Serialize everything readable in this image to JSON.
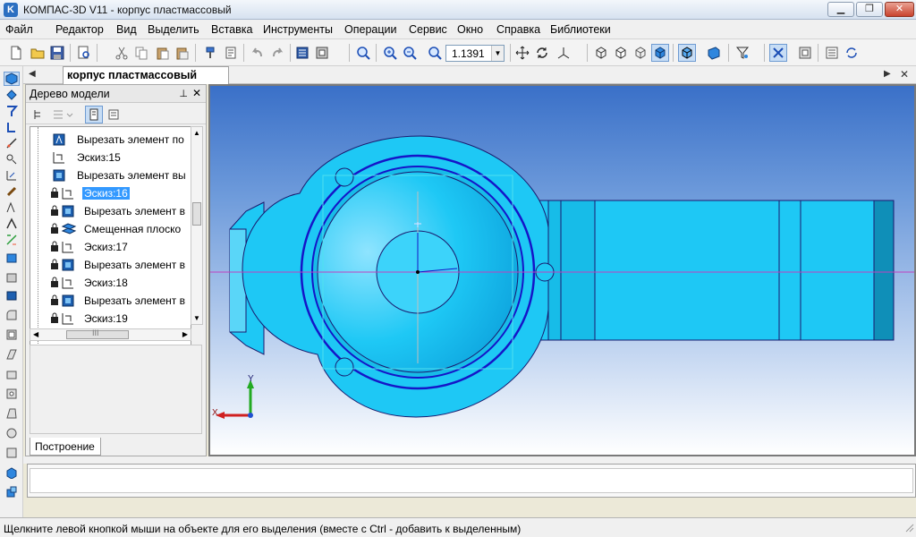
{
  "window": {
    "title": "КОМПАС-3D V11 - корпус пластмассовый",
    "app_icon_letter": "K",
    "minimize_glyph": "▁",
    "restore_glyph": "❐",
    "close_glyph": "✕"
  },
  "menu": [
    {
      "label": "Файл"
    },
    {
      "label": "Редактор"
    },
    {
      "label": "Вид"
    },
    {
      "label": "Выделить"
    },
    {
      "label": "Вставка"
    },
    {
      "label": "Инструменты"
    },
    {
      "label": "Операции"
    },
    {
      "label": "Сервис"
    },
    {
      "label": "Окно"
    },
    {
      "label": "Справка"
    },
    {
      "label": "Библиотеки"
    }
  ],
  "toolbar": {
    "zoom_value": "1.1391",
    "icons": [
      "new-document-icon",
      "open-folder-icon",
      "save-icon",
      "print-preview-icon",
      "cut-icon",
      "copy-icon",
      "paste-icon",
      "format-painter-icon",
      "undo-icon",
      "redo-icon",
      "manager-icon",
      "view-manager-icon",
      "zoom-window-icon",
      "zoom-in-icon",
      "zoom-out-icon",
      "zoom-scale-icon",
      "pan-icon",
      "rotate-icon",
      "orientation-icon",
      "wireframe-icon",
      "hidden-lines-icon",
      "hidden-thin-icon",
      "halftone-icon",
      "halftone-edges-icon",
      "perspective-icon",
      "filter-icon",
      "snap-icon",
      "library-icon",
      "variables-icon",
      "refresh-icon"
    ]
  },
  "document_tab": {
    "label": "корпус пластмассовый"
  },
  "tree": {
    "header": "Дерево модели",
    "pin_glyph": "⊥",
    "close_glyph": "✕",
    "items": [
      {
        "label": "Вырезать элемент по",
        "icon": "cut-extrude-path-icon",
        "locked": false,
        "selected": false
      },
      {
        "label": "Эскиз:15",
        "icon": "sketch-icon",
        "locked": false,
        "selected": false
      },
      {
        "label": "Вырезать элемент вы",
        "icon": "cut-extrude-icon",
        "locked": false,
        "selected": false
      },
      {
        "label": "Эскиз:16",
        "icon": "sketch-icon",
        "locked": true,
        "selected": true
      },
      {
        "label": "Вырезать элемент в",
        "icon": "cut-extrude-icon",
        "locked": true,
        "selected": false
      },
      {
        "label": "Смещенная плоско",
        "icon": "offset-plane-icon",
        "locked": true,
        "selected": false
      },
      {
        "label": "Эскиз:17",
        "icon": "sketch-icon",
        "locked": true,
        "selected": false
      },
      {
        "label": "Вырезать элемент в",
        "icon": "cut-extrude-icon",
        "locked": true,
        "selected": false
      },
      {
        "label": "Эскиз:18",
        "icon": "sketch-icon",
        "locked": true,
        "selected": false
      },
      {
        "label": "Вырезать элемент в",
        "icon": "cut-extrude-icon",
        "locked": true,
        "selected": false
      },
      {
        "label": "Эскиз:19",
        "icon": "sketch-icon",
        "locked": true,
        "selected": false
      }
    ],
    "bottom_tab": "Построение",
    "hscroll_grip": "III"
  },
  "viewport": {
    "axis_x_label": "X",
    "axis_y_label": "Y",
    "colors": {
      "model_fill": "#1EC8F5",
      "model_edge": "#1A1A6E",
      "highlight": "#1515C8",
      "axis_magenta": "#C040C0"
    }
  },
  "status": {
    "message": "Щелкните левой кнопкой мыши на объекте для его выделения (вместе с Ctrl - добавить к выделенным)"
  }
}
